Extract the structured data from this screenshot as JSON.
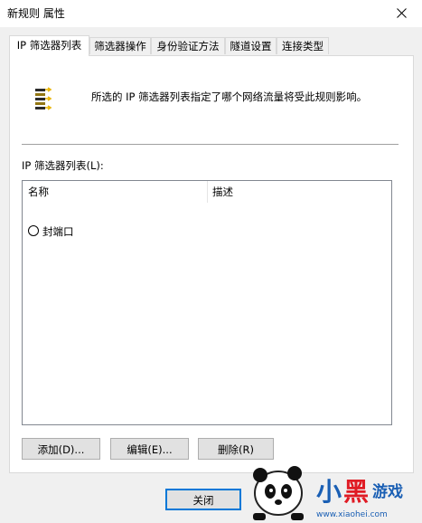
{
  "window": {
    "title": "新规则 属性",
    "close_icon": "close-icon"
  },
  "tabs": [
    {
      "label": "IP 筛选器列表",
      "active": true
    },
    {
      "label": "筛选器操作"
    },
    {
      "label": "身份验证方法"
    },
    {
      "label": "隧道设置"
    },
    {
      "label": "连接类型"
    }
  ],
  "panel": {
    "icon": "filter-list-icon",
    "description": "所选的 IP 筛选器列表指定了哪个网络流量将受此规则影响。",
    "list_label": "IP 筛选器列表(L):",
    "columns": [
      "名称",
      "描述"
    ],
    "rows": [
      {
        "name": "封端口",
        "description": "",
        "selected": false
      }
    ]
  },
  "buttons": {
    "add": "添加(D)...",
    "edit": "编辑(E)...",
    "delete": "删除(R)",
    "close": "关闭"
  },
  "watermark": {
    "text": "小黑游戏",
    "url": "www.xiaohei.com",
    "colors": {
      "blue": "#1a5fb4",
      "red": "#e01b24"
    }
  }
}
